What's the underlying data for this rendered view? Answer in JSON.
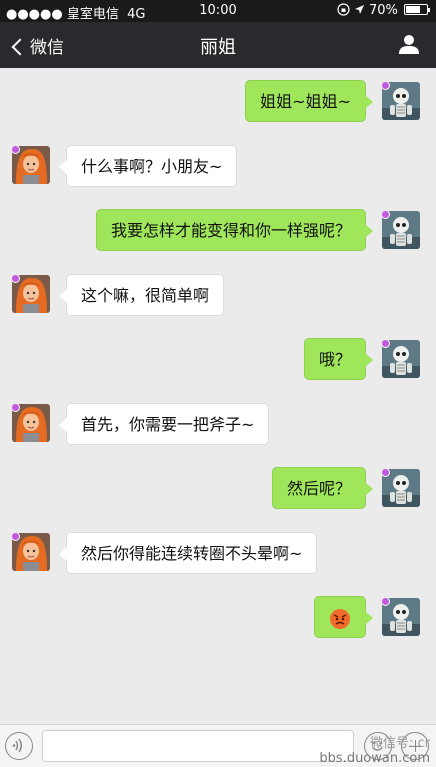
{
  "status_bar": {
    "carrier": "●●●●● 皇室电信",
    "network": "4G",
    "time": "10:00",
    "battery": "70%",
    "battery_level": 0.7
  },
  "nav": {
    "back_label": "微信",
    "title": "丽姐"
  },
  "messages": [
    {
      "side": "out",
      "text": "姐姐~姐姐~"
    },
    {
      "side": "in",
      "text": "什么事啊？小朋友~"
    },
    {
      "side": "out",
      "text": "我要怎样才能变得和你一样强呢？"
    },
    {
      "side": "in",
      "text": "这个嘛，很简单啊"
    },
    {
      "side": "out",
      "text": "哦？"
    },
    {
      "side": "in",
      "text": "首先，你需要一把斧子~"
    },
    {
      "side": "out",
      "text": "然后呢？"
    },
    {
      "side": "in",
      "text": "然后你得能连续转圈不头晕啊~"
    },
    {
      "side": "out",
      "text": "",
      "emoji": "angry-face"
    }
  ],
  "input": {
    "placeholder": ""
  },
  "watermark": {
    "line1": "微信号: cr",
    "line2": "bbs.duowan.com"
  },
  "colors": {
    "status_bar": "#1a1a1a",
    "nav_bar": "#2a2a2e",
    "chat_bg": "#ebebeb",
    "outgoing_bubble": "#9fe65b",
    "incoming_bubble": "#ffffff"
  }
}
